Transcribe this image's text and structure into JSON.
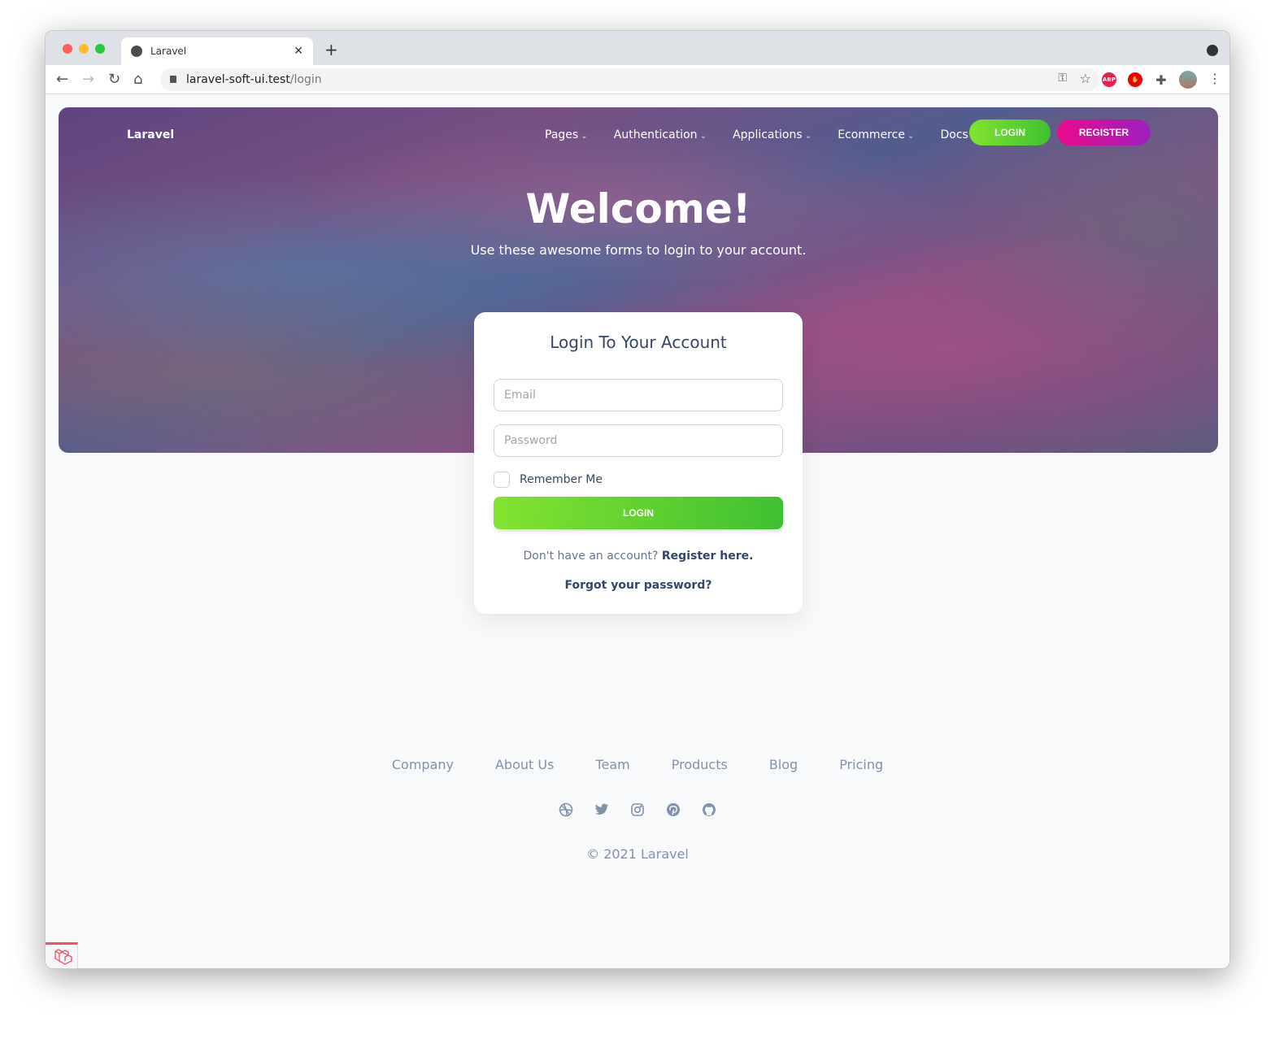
{
  "browser": {
    "tab_title": "Laravel",
    "url_host": "laravel-soft-ui.test",
    "url_path": "/login"
  },
  "nav": {
    "brand": "Laravel",
    "items": [
      {
        "label": "Pages"
      },
      {
        "label": "Authentication"
      },
      {
        "label": "Applications"
      },
      {
        "label": "Ecommerce"
      },
      {
        "label": "Docs"
      }
    ],
    "login": "LOGIN",
    "register": "REGISTER"
  },
  "hero": {
    "title": "Welcome!",
    "subtitle": "Use these awesome forms to login to your account."
  },
  "card": {
    "title": "Login To Your Account",
    "email_placeholder": "Email",
    "password_placeholder": "Password",
    "remember": "Remember Me",
    "login": "LOGIN",
    "no_account": "Don't have an account?",
    "register_link": "Register here.",
    "forgot": "Forgot your password?"
  },
  "footer": {
    "links": [
      "Company",
      "About Us",
      "Team",
      "Products",
      "Blog",
      "Pricing"
    ],
    "social": [
      "dribbble-icon",
      "twitter-icon",
      "instagram-icon",
      "pinterest-icon",
      "github-icon"
    ],
    "copyright": "© 2021 Laravel"
  },
  "colors": {
    "green_start": "#84e330",
    "green_end": "#3fc032",
    "pink": "#ea0b8c",
    "purple": "#9c1fbf",
    "text_dark": "#344767",
    "text_muted": "#8392ab"
  }
}
